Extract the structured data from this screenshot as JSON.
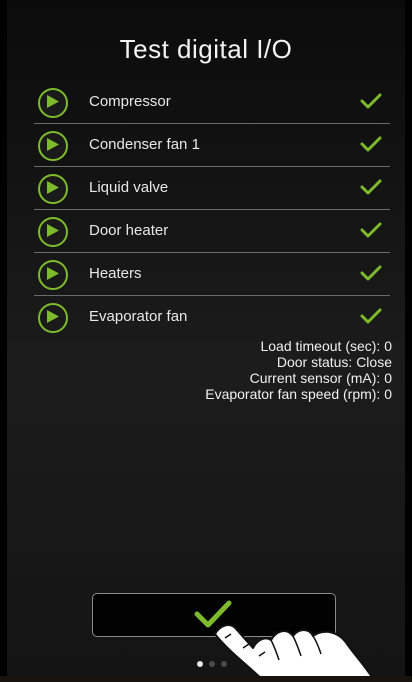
{
  "screen": {
    "title": "Test digital I/O"
  },
  "outputs": [
    {
      "label": "Compressor",
      "play_icon": "play-icon",
      "status_icon": "checkmark-icon"
    },
    {
      "label": "Condenser fan 1",
      "play_icon": "play-icon",
      "status_icon": "checkmark-icon"
    },
    {
      "label": "Liquid valve",
      "play_icon": "play-icon",
      "status_icon": "checkmark-icon"
    },
    {
      "label": "Door heater",
      "play_icon": "play-icon",
      "status_icon": "checkmark-icon"
    },
    {
      "label": "Heaters",
      "play_icon": "play-icon",
      "status_icon": "checkmark-icon"
    },
    {
      "label": "Evaporator fan",
      "play_icon": "play-icon",
      "status_icon": "checkmark-icon"
    }
  ],
  "info": {
    "load_timeout": "Load timeout (sec): 0",
    "door_status": "Door status: Close",
    "current_sensor": "Current sensor (mA): 0",
    "evaporator_fan_speed": "Evaporator fan speed (rpm): 0"
  },
  "confirm_button": {
    "icon": "checkmark-icon"
  },
  "pagination": {
    "pages": 3,
    "active": 1
  },
  "colors": {
    "accent": "#7dbb2c",
    "background": "#111111",
    "text": "#eeeeee"
  }
}
